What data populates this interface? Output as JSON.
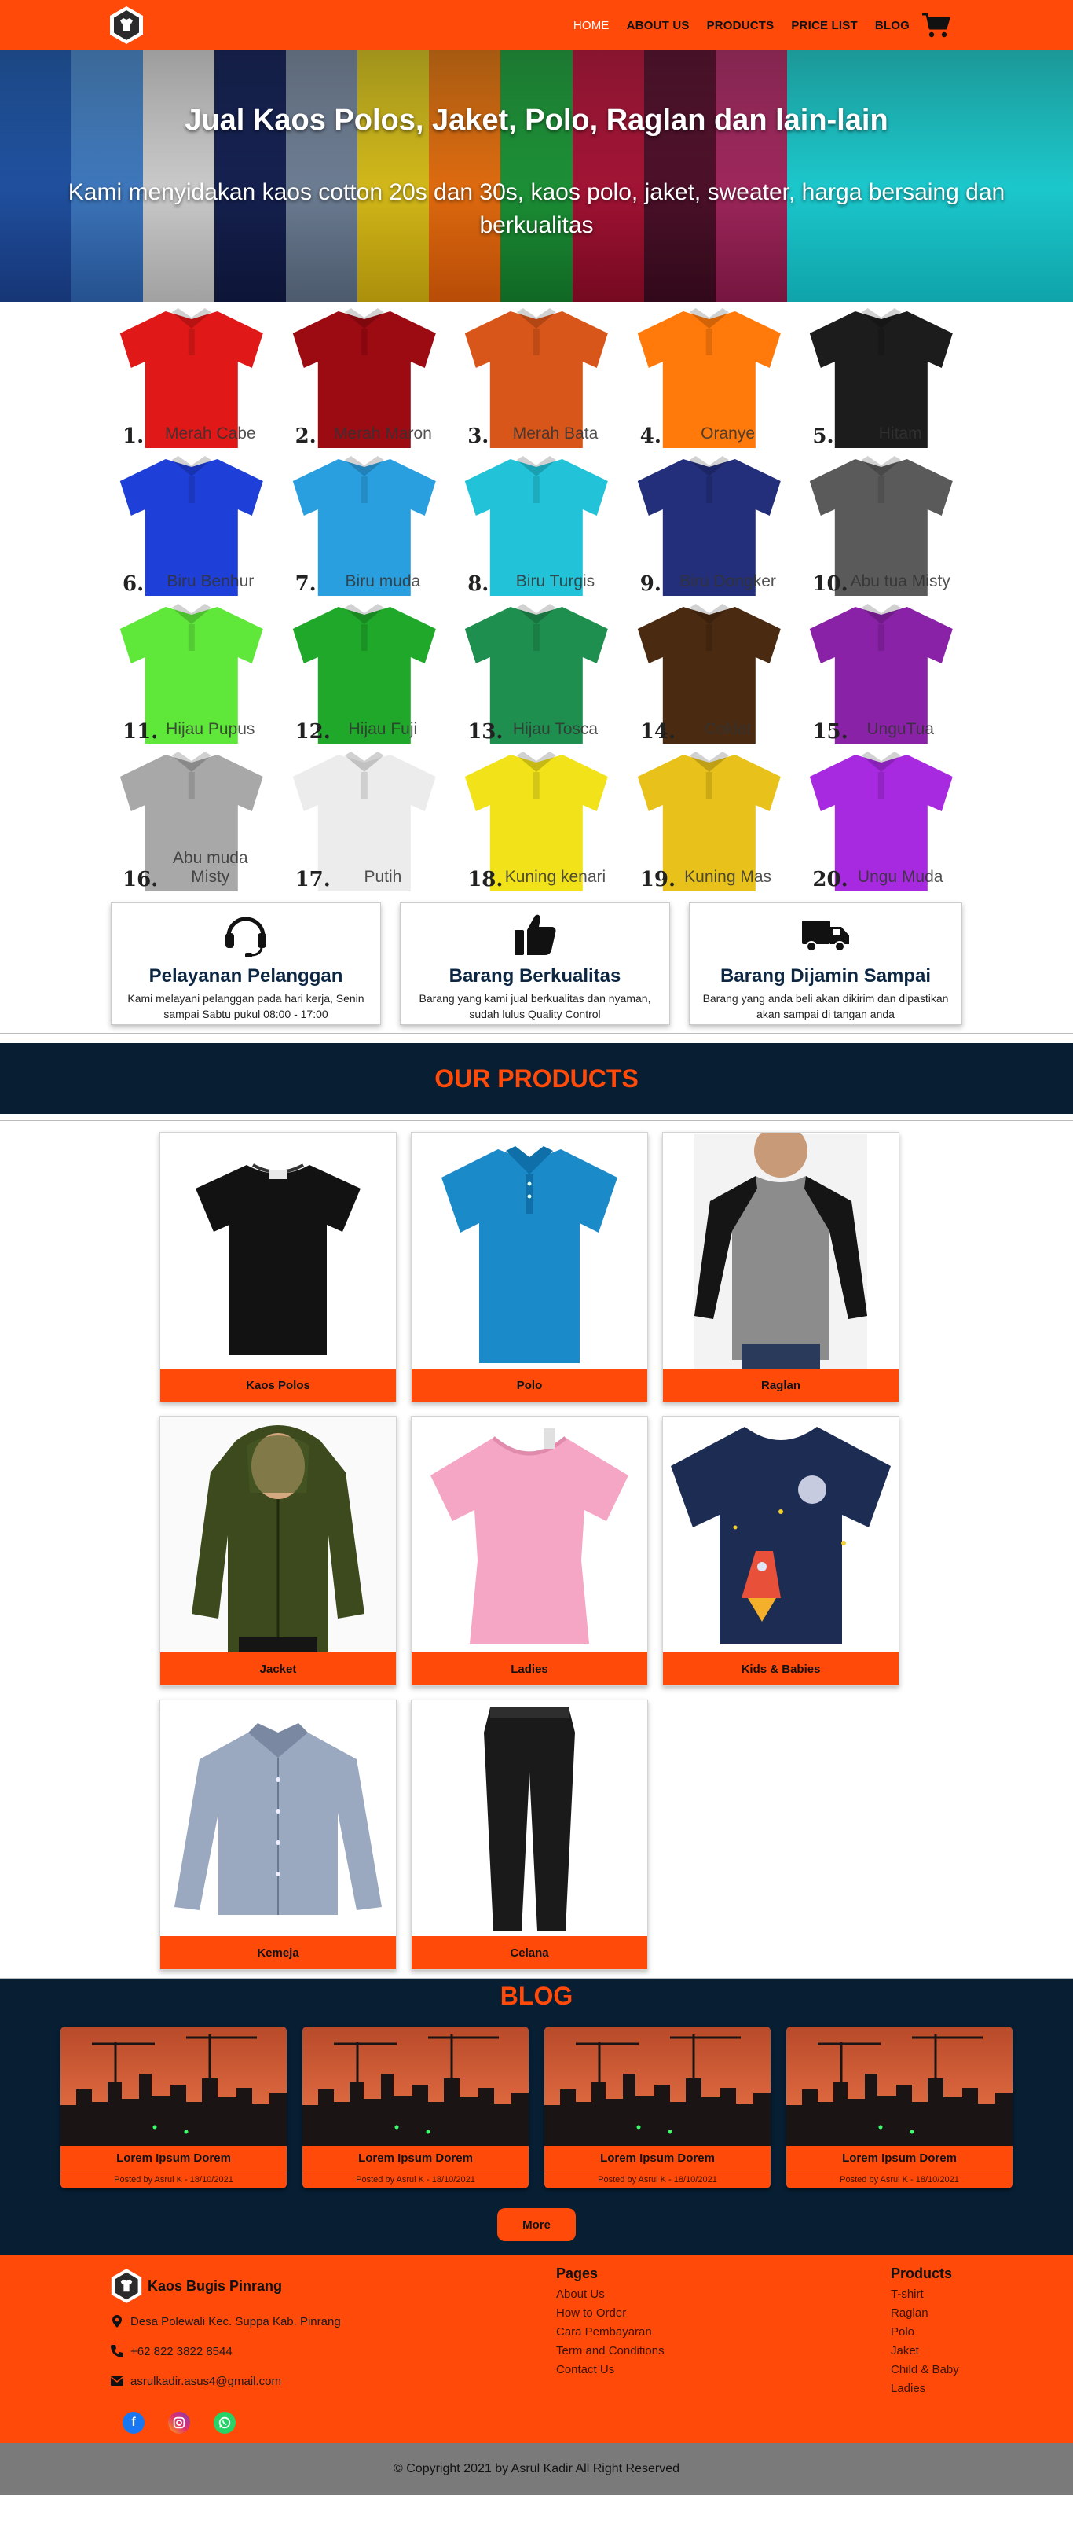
{
  "brand": {
    "name": "Kaos Bugis Pinrang"
  },
  "nav": {
    "items": [
      {
        "label": "HOME",
        "active": true
      },
      {
        "label": "ABOUT US",
        "active": false
      },
      {
        "label": "PRODUCTS",
        "active": false
      },
      {
        "label": "PRICE LIST",
        "active": false
      },
      {
        "label": "BLOG",
        "active": false
      }
    ],
    "cart_icon": "cart-icon"
  },
  "hero": {
    "title": "Jual Kaos Polos, Jaket, Polo, Raglan dan lain-lain",
    "subtitle": "Kami menyidakan kaos cotton 20s dan 30s, kaos polo, jaket, sweater, harga bersaing dan berkualitas"
  },
  "color_chart": [
    {
      "num": "1.",
      "name": "Merah Cabe",
      "color": "#e01818"
    },
    {
      "num": "2.",
      "name": "Merah Maron",
      "color": "#9c0a12"
    },
    {
      "num": "3.",
      "name": "Merah Bata",
      "color": "#d9561a"
    },
    {
      "num": "4.",
      "name": "Oranye",
      "color": "#ff7a0a"
    },
    {
      "num": "5.",
      "name": "Hitam",
      "color": "#1c1c1c"
    },
    {
      "num": "6.",
      "name": "Biru Benhur",
      "color": "#1e3fd8"
    },
    {
      "num": "7.",
      "name": "Biru muda",
      "color": "#2a9fe0"
    },
    {
      "num": "8.",
      "name": "Biru Turgis",
      "color": "#22c3d8"
    },
    {
      "num": "9.",
      "name": "Biru Dongker",
      "color": "#232f7a"
    },
    {
      "num": "10.",
      "name": "Abu tua Misty",
      "color": "#5a5a5a"
    },
    {
      "num": "11.",
      "name": "Hijau Pupus",
      "color": "#5fe83a"
    },
    {
      "num": "12.",
      "name": "Hijau Fuji",
      "color": "#1fa82a"
    },
    {
      "num": "13.",
      "name": "Hijau Tosca",
      "color": "#1e8f4e"
    },
    {
      "num": "14.",
      "name": "Coklat",
      "color": "#4a2a10"
    },
    {
      "num": "15.",
      "name": "UnguTua",
      "color": "#8a22a8"
    },
    {
      "num": "16.",
      "name": "Abu muda Misty",
      "color": "#a8a8a8"
    },
    {
      "num": "17.",
      "name": "Putih",
      "color": "#ececec"
    },
    {
      "num": "18.",
      "name": "Kuning kenari",
      "color": "#f2e21a"
    },
    {
      "num": "19.",
      "name": "Kuning Mas",
      "color": "#e8c21a"
    },
    {
      "num": "20.",
      "name": "Ungu Muda",
      "color": "#a82ae0"
    }
  ],
  "features": [
    {
      "icon": "headset-icon",
      "title": "Pelayanan Pelanggan",
      "desc": "Kami melayani pelanggan pada hari kerja, Senin sampai Sabtu pukul 08:00 - 17:00"
    },
    {
      "icon": "thumbs-up-icon",
      "title": "Barang Berkualitas",
      "desc": "Barang yang kami jual berkualitas dan nyaman, sudah lulus Quality Control"
    },
    {
      "icon": "truck-icon",
      "title": "Barang Dijamin Sampai",
      "desc": "Barang yang anda beli akan dikirim dan dipastikan akan sampai di tangan anda"
    }
  ],
  "products": {
    "title": "OUR PRODUCTS",
    "items": [
      {
        "label": "Kaos Polos",
        "icon": "tshirt-icon"
      },
      {
        "label": "Polo",
        "icon": "polo-icon"
      },
      {
        "label": "Raglan",
        "icon": "raglan-icon"
      },
      {
        "label": "Jacket",
        "icon": "jacket-icon"
      },
      {
        "label": "Ladies",
        "icon": "ladies-tee-icon"
      },
      {
        "label": "Kids & Babies",
        "icon": "kids-tee-icon"
      },
      {
        "label": "Kemeja",
        "icon": "shirt-icon"
      },
      {
        "label": "Celana",
        "icon": "trousers-icon"
      }
    ]
  },
  "blog": {
    "title": "BLOG",
    "posts": [
      {
        "title": "Lorem Ipsum Dorem",
        "meta": "Posted by Asrul K - 18/10/2021"
      },
      {
        "title": "Lorem Ipsum Dorem",
        "meta": "Posted by Asrul K - 18/10/2021"
      },
      {
        "title": "Lorem Ipsum Dorem",
        "meta": "Posted by Asrul K - 18/10/2021"
      },
      {
        "title": "Lorem Ipsum Dorem",
        "meta": "Posted by Asrul K - 18/10/2021"
      }
    ],
    "more_label": "More"
  },
  "footer": {
    "address": "Desa Polewali Kec. Suppa Kab. Pinrang",
    "phone": "+62 822 3822 8544",
    "email": "asrulkadir.asus4@gmail.com",
    "social": [
      "facebook-icon",
      "instagram-icon",
      "whatsapp-icon"
    ],
    "pages": {
      "title": "Pages",
      "links": [
        "About Us",
        "How to Order",
        "Cara Pembayaran",
        "Term and Conditions",
        "Contact Us"
      ]
    },
    "product_links": {
      "title": "Products",
      "links": [
        "T-shirt",
        "Raglan",
        "Polo",
        "Jaket",
        "Child & Baby",
        "Ladies"
      ]
    },
    "copyright": "© Copyright 2021 by Asrul Kadir All Right Reserved"
  },
  "colors": {
    "brand_orange": "#ff4a0a",
    "navy": "#071e33",
    "footer_gray": "#7a7a7a"
  }
}
